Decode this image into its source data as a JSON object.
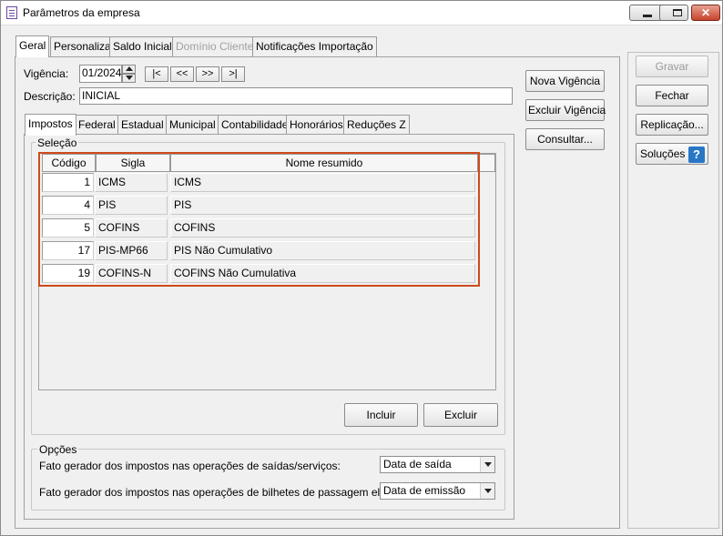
{
  "window": {
    "title": "Parâmetros da empresa",
    "controls": {
      "minimize": "minimize-icon",
      "maximize": "maximize-icon",
      "close": "✕"
    }
  },
  "main_tabs": [
    "Geral",
    "Personaliza",
    "Saldo Inicial",
    "Domínio Cliente",
    "Notificações Importação"
  ],
  "vigencia": {
    "label": "Vigência:",
    "value": "01/2024",
    "nav": {
      "first": "|<",
      "prev": "<<",
      "next": ">>",
      "last": ">|"
    }
  },
  "descricao": {
    "label": "Descrição:",
    "value": "INICIAL"
  },
  "sub_tabs": [
    "Impostos",
    "Federal",
    "Estadual",
    "Municipal",
    "Contabilidade",
    "Honorários",
    "Reduções Z"
  ],
  "selecao": {
    "title": "Seleção",
    "columns": {
      "codigo": "Código",
      "sigla": "Sigla",
      "nome": "Nome resumido"
    },
    "rows": [
      {
        "codigo": "1",
        "sigla": "ICMS",
        "nome": "ICMS"
      },
      {
        "codigo": "4",
        "sigla": "PIS",
        "nome": "PIS"
      },
      {
        "codigo": "5",
        "sigla": "COFINS",
        "nome": "COFINS"
      },
      {
        "codigo": "17",
        "sigla": "PIS-MP66",
        "nome": "PIS Não Cumulativo"
      },
      {
        "codigo": "19",
        "sigla": "COFINS-N",
        "nome": "COFINS Não Cumulativa"
      }
    ],
    "incluir": "Incluir",
    "excluir": "Excluir"
  },
  "opcoes": {
    "title": "Opções",
    "fato_saidas_label": "Fato gerador dos impostos nas operações de saídas/serviços:",
    "fato_saidas_value": "Data de saída",
    "fato_bilhetes_label": "Fato gerador dos impostos nas operações de bilhetes de passagem eletrônico:",
    "fato_bilhetes_value": "Data de emissão"
  },
  "vigencia_buttons": {
    "nova": "Nova Vigência",
    "excluir": "Excluir Vigência",
    "consultar": "Consultar..."
  },
  "side_buttons": {
    "gravar": "Gravar",
    "fechar": "Fechar",
    "replicacao": "Replicação...",
    "solucoes": "Soluções",
    "help": "?"
  },
  "colors": {
    "highlight": "#cf4a1c",
    "help_blue": "#2777c6"
  }
}
